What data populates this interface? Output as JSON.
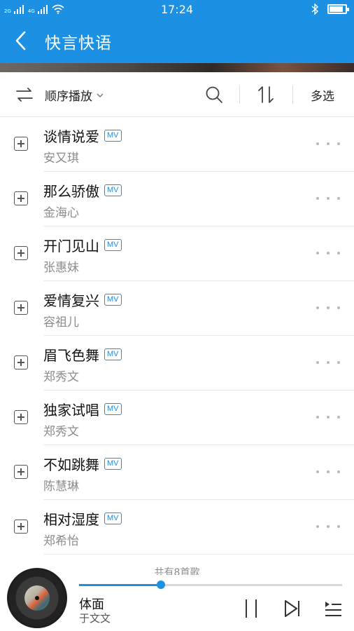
{
  "status_bar": {
    "sim1_tag": "2G",
    "sim2_tag": "4G",
    "time": "17:24",
    "bluetooth_icon": "bluetooth-icon",
    "battery_icon": "battery-icon",
    "battery_level": 0.8
  },
  "header": {
    "title": "快言快语",
    "back_icon": "chevron-left-icon"
  },
  "toolbar": {
    "play_mode_label": "顺序播放",
    "multi_select_label": "多选",
    "icons": [
      "play-order-icon",
      "chevron-down-icon",
      "search-icon",
      "sort-icon"
    ]
  },
  "songs": [
    {
      "title": "谈情说爱",
      "artist": "安又琪",
      "badge": "MV"
    },
    {
      "title": "那么骄傲",
      "artist": "金海心",
      "badge": "MV"
    },
    {
      "title": "开门见山",
      "artist": "张惠妹",
      "badge": "MV"
    },
    {
      "title": "爱情复兴",
      "artist": "容祖儿",
      "badge": "MV"
    },
    {
      "title": "眉飞色舞",
      "artist": "郑秀文",
      "badge": "MV"
    },
    {
      "title": "独家试唱",
      "artist": "郑秀文",
      "badge": "MV"
    },
    {
      "title": "不如跳舞",
      "artist": "陈慧琳",
      "badge": "MV"
    },
    {
      "title": "相对湿度",
      "artist": "郑希怡",
      "badge": "MV"
    }
  ],
  "list_footer": {
    "count_text": "共有8首歌"
  },
  "player": {
    "title": "体面",
    "artist": "于文文",
    "progress": 0.31,
    "colors": {
      "accent": "#1c90e2"
    },
    "icons": [
      "pause-icon",
      "next-icon",
      "playlist-icon"
    ]
  }
}
